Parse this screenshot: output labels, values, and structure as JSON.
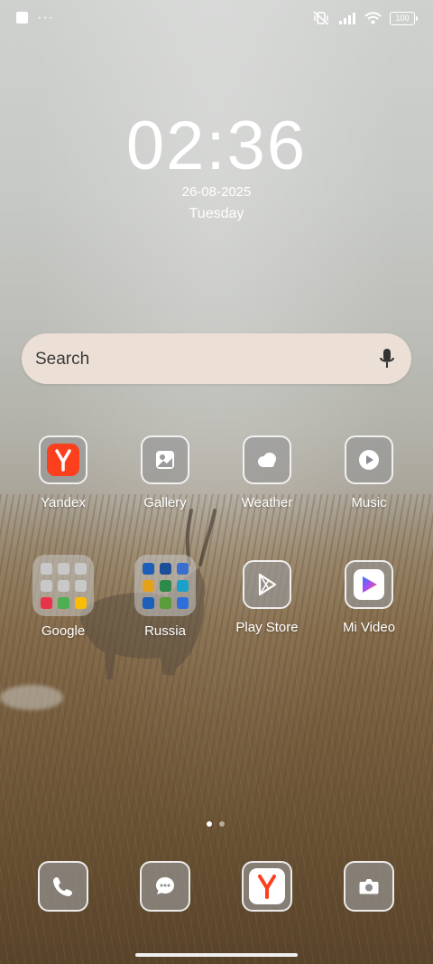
{
  "status_bar": {
    "battery": "100",
    "icons": [
      "square-icon",
      "more-dots-icon",
      "vibrate-off-icon",
      "signal-icon",
      "wifi-icon",
      "battery-icon"
    ]
  },
  "clock": {
    "time": "02:36",
    "date": "26-08-2025",
    "weekday": "Tuesday"
  },
  "search": {
    "label": "Search",
    "icon": "mic-icon"
  },
  "apps": [
    {
      "label": "Yandex",
      "icon": "yandex-icon"
    },
    {
      "label": "Gallery",
      "icon": "gallery-icon"
    },
    {
      "label": "Weather",
      "icon": "weather-icon"
    },
    {
      "label": "Music",
      "icon": "music-icon"
    },
    {
      "label": "Google",
      "icon": "google-folder-icon"
    },
    {
      "label": "Russia",
      "icon": "russia-folder-icon"
    },
    {
      "label": "Play Store",
      "icon": "play-store-icon"
    },
    {
      "label": "Mi Video",
      "icon": "mi-video-icon"
    }
  ],
  "google_folder_colors": [
    "#9aa0a6",
    "#9aa0a6",
    "#9aa0a6",
    "#9aa0a6",
    "#9aa0a6",
    "#9aa0a6",
    "#e8334a",
    "#4caf50",
    "#fbbc05"
  ],
  "russia_folder_colors": [
    "#1b5fb8",
    "#1c4f99",
    "#3a6fcf",
    "#e3a21a",
    "#2d8a4a",
    "#1aa0c9",
    "#1b5fb8",
    "#5a9b3a",
    "#2f6edb"
  ],
  "dock": [
    {
      "icon": "phone-icon"
    },
    {
      "icon": "messages-icon"
    },
    {
      "icon": "yandex-browser-icon"
    },
    {
      "icon": "camera-icon"
    }
  ],
  "page_indicator": {
    "pages": 2,
    "active": 1
  },
  "colors": {
    "yandex_red": "#fc3f1d",
    "search_bg": "#ece0d6",
    "icon_tile": "#969696"
  }
}
